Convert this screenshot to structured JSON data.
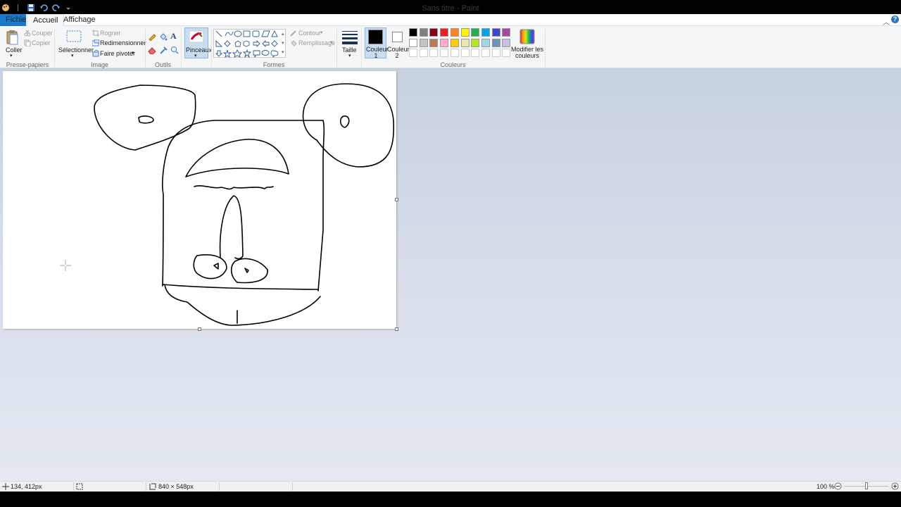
{
  "window": {
    "title": "Sans titre - Paint"
  },
  "tabs": {
    "file": "Fichier",
    "home": "Accueil",
    "view": "Affichage"
  },
  "ribbon": {
    "clipboard": {
      "group_label": "Presse-papiers",
      "paste": "Coller",
      "cut": "Couper",
      "copy": "Copier"
    },
    "image": {
      "group_label": "Image",
      "select": "Sélectionner",
      "crop": "Rogner",
      "resize": "Redimensionner",
      "rotate": "Faire pivoter"
    },
    "tools": {
      "group_label": "Outils"
    },
    "brushes": {
      "label": "Pinceaux"
    },
    "shapes": {
      "group_label": "Formes",
      "outline": "Contour",
      "fill": "Remplissage"
    },
    "size": {
      "label": "Taille"
    },
    "colors": {
      "group_label": "Couleurs",
      "color1_label_line1": "Couleur",
      "color1_label_line2": "1",
      "color2_label_line1": "Couleur",
      "color2_label_line2": "2",
      "edit_colors_line1": "Modifier les",
      "edit_colors_line2": "couleurs",
      "color1_value": "#000000",
      "color2_value": "#ffffff",
      "palette_row1": [
        "#000000",
        "#7f7f7f",
        "#880015",
        "#ed1c24",
        "#ff7f27",
        "#fff200",
        "#22b14c",
        "#00a2e8",
        "#3f48cc",
        "#a349a4"
      ],
      "palette_row2": [
        "#ffffff",
        "#c3c3c3",
        "#b97a57",
        "#ffaec9",
        "#ffc90e",
        "#efe4b0",
        "#b5e61d",
        "#99d9ea",
        "#7092be",
        "#c8bfe7"
      ]
    }
  },
  "status": {
    "cursor_pos": "134, 412px",
    "canvas_size": "840 × 548px",
    "zoom": "100 %",
    "zoom_fraction": 0.5
  }
}
